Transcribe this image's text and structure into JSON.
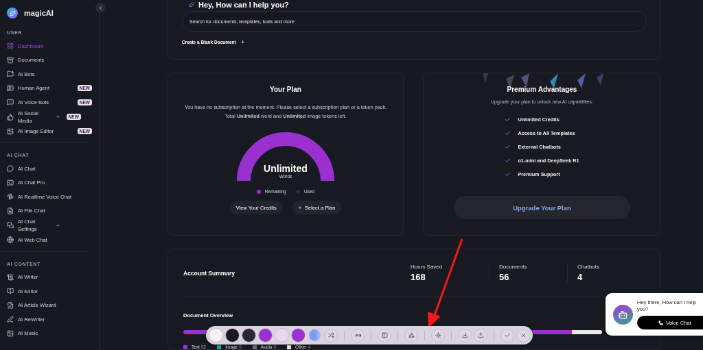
{
  "brand": {
    "name": "magicAI"
  },
  "sidebar": {
    "sections": [
      {
        "title": "USER",
        "items": [
          {
            "label": "Dashboard",
            "selected": true
          },
          {
            "label": "Documents",
            "selected": false
          },
          {
            "label": "AI Bots",
            "selected": false
          },
          {
            "label": "Human Agent",
            "selected": false,
            "badge": "NEW"
          },
          {
            "label": "AI Voice Bots",
            "selected": false,
            "badge": "NEW"
          },
          {
            "label": "AI Social Media",
            "selected": false,
            "action": "+",
            "badge": "NEW"
          },
          {
            "label": "AI Image Editor",
            "selected": false,
            "badge": "NEW"
          }
        ]
      },
      {
        "title": "AI CHAT",
        "items": [
          {
            "label": "AI Chat",
            "selected": false
          },
          {
            "label": "AI Chat Pro",
            "selected": false
          },
          {
            "label": "AI Realtime Voice Chat",
            "selected": false
          },
          {
            "label": "AI File Chat",
            "selected": false
          },
          {
            "label": "AI Chat Settings",
            "selected": false,
            "action": "+"
          },
          {
            "label": "AI Web Chat",
            "selected": false
          }
        ]
      },
      {
        "title": "AI CONTENT",
        "items": [
          {
            "label": "AI Writer",
            "selected": false
          },
          {
            "label": "AI Editor",
            "selected": false
          },
          {
            "label": "AI Article Wizard",
            "selected": false
          },
          {
            "label": "AI ReWriter",
            "selected": false
          },
          {
            "label": "AI Music",
            "selected": false
          }
        ]
      }
    ]
  },
  "hero": {
    "heading": "Hey, How can I help you?",
    "search": {
      "placeholder": "Search for documents, templates, tools and more"
    },
    "create_link": "Create a Blank Document",
    "create_icon": "+"
  },
  "plan": {
    "title": "Your Plan",
    "description": "You have no subscription at the moment. Please select a subscription plan or a token pack. Total **Unlimited** word and **Unlimited** image tokens left.",
    "gauge": {
      "value": "Unlimited",
      "unit": "Words"
    },
    "legend": [
      {
        "label": "Remaining",
        "color": "#9b30d0"
      },
      {
        "label": "Used",
        "color": "#3a2346"
      }
    ],
    "buttons": [
      {
        "label": "View Your Credits"
      },
      {
        "label": "Select a Plan",
        "icon": "+"
      }
    ]
  },
  "premium": {
    "title": "Premium Advantages",
    "subtitle": "Upgrade your plan to unlock new AI capabilities.",
    "features": [
      "Unlimited Credits",
      "Access to All Templates",
      "External Chatbots",
      "o1-mini and DeepSeek R1",
      "Premium Support"
    ],
    "button": "Upgrade Your Plan"
  },
  "summary": {
    "title": "Account Summary",
    "stats": [
      {
        "label": "Hours Saved",
        "value": "168"
      },
      {
        "label": "Documents",
        "value": "56"
      },
      {
        "label": "Chatbots",
        "value": "4"
      }
    ],
    "overview_title": "Document Overview",
    "legend": [
      {
        "label": "Text",
        "count": "52",
        "color": "#9b30d0"
      },
      {
        "label": "Image",
        "count": "0",
        "color": "#1fa88f"
      },
      {
        "label": "Audio",
        "count": "0",
        "color": "#6b6f7a"
      },
      {
        "label": "Other",
        "count": "4",
        "color": "#e8e8e8"
      }
    ]
  },
  "toolbar": {
    "swatches": [
      {
        "color": "#f4f4f6"
      },
      {
        "color": "#181b22"
      },
      {
        "color": "#262931"
      },
      {
        "color": "#9b30d0"
      },
      {
        "color": "#e8d8ec"
      },
      {
        "color": "#9b30d0"
      }
    ]
  },
  "chat_widget": {
    "message": "Hey there, How can I help you?",
    "button": "Voice Chat"
  }
}
